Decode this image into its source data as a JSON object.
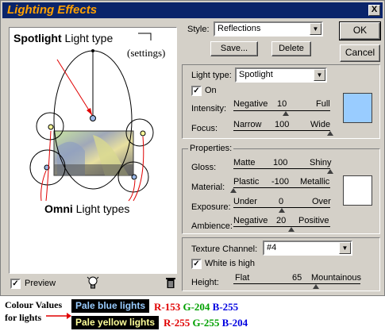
{
  "window": {
    "title": "Lighting Effects",
    "close_glyph": "X"
  },
  "preview": {
    "spotlight_bold": "Spotlight",
    "spotlight_rest": " Light type",
    "settings_note": "(settings)",
    "omni_bold": "Omni",
    "omni_rest": " Light types",
    "preview_label": "Preview",
    "preview_checked": true,
    "bulb_icon": "lightbulb-icon",
    "trash_icon": "trash-icon"
  },
  "style": {
    "label": "Style:",
    "value": "Reflections",
    "save_label": "Save...",
    "delete_label": "Delete"
  },
  "buttons": {
    "ok": "OK",
    "cancel": "Cancel"
  },
  "light_type": {
    "label": "Light type:",
    "value": "Spotlight",
    "on_label": "On",
    "on_checked": true,
    "intensity": {
      "label": "Intensity:",
      "min": "Negative",
      "value": "10",
      "max": "Full",
      "fraction": 0.55
    },
    "focus": {
      "label": "Focus:",
      "min": "Narrow",
      "value": "100",
      "max": "Wide",
      "fraction": 1.0
    },
    "color": "#99ccff"
  },
  "properties": {
    "title": "Properties:",
    "gloss": {
      "label": "Gloss:",
      "min": "Matte",
      "value": "100",
      "max": "Shiny",
      "fraction": 1.0
    },
    "material": {
      "label": "Material:",
      "min": "Plastic",
      "value": "-100",
      "max": "Metallic",
      "fraction": 0.0
    },
    "exposure": {
      "label": "Exposure:",
      "min": "Under",
      "value": "0",
      "max": "Over",
      "fraction": 0.5
    },
    "ambience": {
      "label": "Ambience:",
      "min": "Negative",
      "value": "20",
      "max": "Positive",
      "fraction": 0.6
    },
    "color": "#ffffff"
  },
  "texture": {
    "label": "Texture Channel:",
    "value": "#4",
    "white_high_label": "White is high",
    "white_high_checked": true,
    "height": {
      "label": "Height:",
      "min": "Flat",
      "value": "65",
      "max": "Mountainous",
      "fraction": 0.65
    }
  },
  "legend": {
    "title_line1": "Colour Values",
    "title_line2": "for lights",
    "blue_label": "Pale blue lights",
    "blue_r": "R-153",
    "blue_g": "G-204",
    "blue_b": "B-255",
    "yellow_label": "Pale yellow lights",
    "yellow_r": "R-255",
    "yellow_g": "G-255",
    "yellow_b": "B-204",
    "blue_color": "#99ccff",
    "yellow_color": "#ffff99"
  }
}
